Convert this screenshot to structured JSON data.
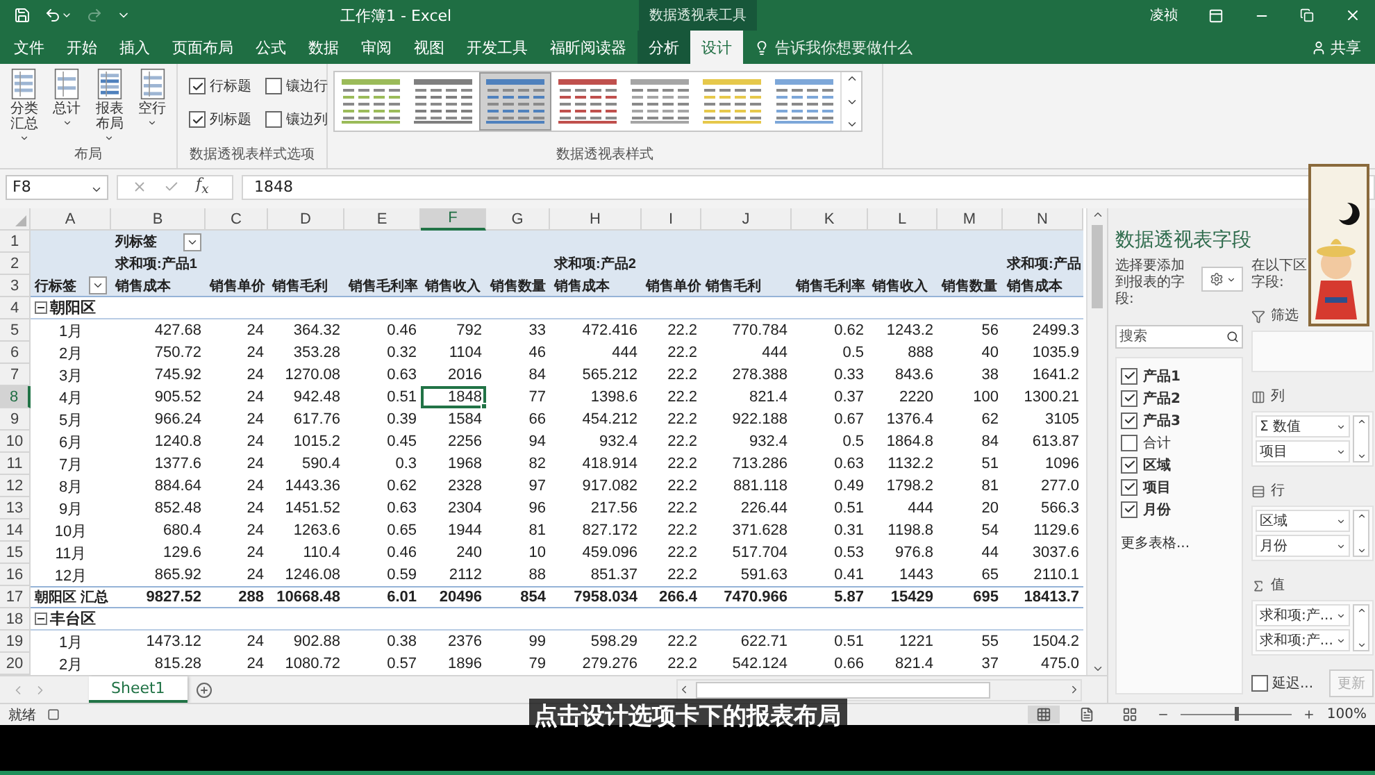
{
  "title_bar": {
    "title": "工作簿1 - Excel",
    "context_header": "数据透视表工具",
    "user": "凌祯"
  },
  "tabs": [
    {
      "label": "文件",
      "selected": false,
      "kind": "normal"
    },
    {
      "label": "开始",
      "selected": false,
      "kind": "normal"
    },
    {
      "label": "插入",
      "selected": false,
      "kind": "normal"
    },
    {
      "label": "页面布局",
      "selected": false,
      "kind": "normal"
    },
    {
      "label": "公式",
      "selected": false,
      "kind": "normal"
    },
    {
      "label": "数据",
      "selected": false,
      "kind": "normal"
    },
    {
      "label": "审阅",
      "selected": false,
      "kind": "normal"
    },
    {
      "label": "视图",
      "selected": false,
      "kind": "normal"
    },
    {
      "label": "开发工具",
      "selected": false,
      "kind": "normal"
    },
    {
      "label": "福昕阅读器",
      "selected": false,
      "kind": "normal"
    },
    {
      "label": "分析",
      "selected": false,
      "kind": "contextual"
    },
    {
      "label": "设计",
      "selected": true,
      "kind": "contextual"
    }
  ],
  "tell_me": {
    "placeholder": "告诉我你想要做什么"
  },
  "share": "共享",
  "ribbon": {
    "layout": {
      "label": "布局",
      "buttons": [
        {
          "label": "分类汇总",
          "kind": "subtotals"
        },
        {
          "label": "总计",
          "kind": "totals"
        },
        {
          "label": "报表布局",
          "kind": "report"
        },
        {
          "label": "空行",
          "kind": "blank"
        }
      ]
    },
    "options": {
      "label": "数据透视表样式选项",
      "items": [
        {
          "label": "行标题",
          "checked": true
        },
        {
          "label": "镶边行",
          "checked": false
        },
        {
          "label": "列标题",
          "checked": true
        },
        {
          "label": "镶边列",
          "checked": false
        }
      ]
    },
    "styles": {
      "label": "数据透视表样式",
      "items": [
        {
          "color": "#9bbb59",
          "selected": false
        },
        {
          "color": "#7f7f7f",
          "selected": false
        },
        {
          "color": "#4f81bd",
          "selected": true
        },
        {
          "color": "#c0504d",
          "selected": false
        },
        {
          "color": "#a5a5a5",
          "selected": false
        },
        {
          "color": "#e6c84b",
          "selected": false
        },
        {
          "color": "#7da7d9",
          "selected": false
        }
      ]
    }
  },
  "formula_bar": {
    "name_box": "F8",
    "fx": "f$_{x}$",
    "value": "1848"
  },
  "table": {
    "columns": [
      {
        "label": "A",
        "selected": false
      },
      {
        "label": "B",
        "selected": false
      },
      {
        "label": "C",
        "selected": false
      },
      {
        "label": "D",
        "selected": false
      },
      {
        "label": "E",
        "selected": false
      },
      {
        "label": "F",
        "selected": true
      },
      {
        "label": "G",
        "selected": false
      },
      {
        "label": "H",
        "selected": false
      },
      {
        "label": "I",
        "selected": false
      },
      {
        "label": "J",
        "selected": false
      },
      {
        "label": "K",
        "selected": false
      },
      {
        "label": "L",
        "selected": false
      },
      {
        "label": "M",
        "selected": false
      },
      {
        "label": "N",
        "selected": false
      }
    ],
    "rows": [
      {
        "num": "1",
        "selected": false,
        "kind": "header",
        "cells": [
          null,
          {
            "text": "列标签",
            "dropdown": true
          }
        ]
      },
      {
        "num": "2",
        "selected": false,
        "kind": "header",
        "cells": [
          null,
          "求和项:产品1",
          null,
          null,
          null,
          null,
          null,
          "求和项:产品2",
          null,
          null,
          null,
          null,
          null,
          "求和项:产品"
        ]
      },
      {
        "num": "3",
        "selected": false,
        "kind": "header",
        "cells": [
          {
            "text": "行标签",
            "dropdown": true
          },
          "销售成本",
          "销售单价",
          "销售毛利",
          "销售毛利率",
          "销售收入",
          "销售数量",
          "销售成本",
          "销售单价",
          "销售毛利",
          "销售毛利率",
          "销售收入",
          "销售数量",
          "销售成本"
        ]
      },
      {
        "num": "4",
        "selected": false,
        "kind": "group",
        "expanded": true,
        "cells": [
          "朝阳区"
        ]
      },
      {
        "num": "5",
        "selected": false,
        "kind": "data",
        "cells": [
          "1月",
          "427.68",
          "24",
          "364.32",
          "0.46",
          "792",
          "33",
          "472.416",
          "22.2",
          "770.784",
          "0.62",
          "1243.2",
          "56",
          "2499.3"
        ]
      },
      {
        "num": "6",
        "selected": false,
        "kind": "data",
        "cells": [
          "2月",
          "750.72",
          "24",
          "353.28",
          "0.32",
          "1104",
          "46",
          "444",
          "22.2",
          "444",
          "0.5",
          "888",
          "40",
          "1035.9"
        ]
      },
      {
        "num": "7",
        "selected": false,
        "kind": "data",
        "cells": [
          "3月",
          "745.92",
          "24",
          "1270.08",
          "0.63",
          "2016",
          "84",
          "565.212",
          "22.2",
          "278.388",
          "0.33",
          "843.6",
          "38",
          "1641.2"
        ]
      },
      {
        "num": "8",
        "selected": true,
        "kind": "data",
        "cells": [
          "4月",
          "905.52",
          "24",
          "942.48",
          "0.51",
          "1848",
          "77",
          "1398.6",
          "22.2",
          "821.4",
          "0.37",
          "2220",
          "100",
          "1300.21"
        ]
      },
      {
        "num": "9",
        "selected": false,
        "kind": "data",
        "cells": [
          "5月",
          "966.24",
          "24",
          "617.76",
          "0.39",
          "1584",
          "66",
          "454.212",
          "22.2",
          "922.188",
          "0.67",
          "1376.4",
          "62",
          "3105"
        ]
      },
      {
        "num": "10",
        "selected": false,
        "kind": "data",
        "cells": [
          "6月",
          "1240.8",
          "24",
          "1015.2",
          "0.45",
          "2256",
          "94",
          "932.4",
          "22.2",
          "932.4",
          "0.5",
          "1864.8",
          "84",
          "613.87"
        ]
      },
      {
        "num": "11",
        "selected": false,
        "kind": "data",
        "cells": [
          "7月",
          "1377.6",
          "24",
          "590.4",
          "0.3",
          "1968",
          "82",
          "418.914",
          "22.2",
          "713.286",
          "0.63",
          "1132.2",
          "51",
          "1096"
        ]
      },
      {
        "num": "12",
        "selected": false,
        "kind": "data",
        "cells": [
          "8月",
          "884.64",
          "24",
          "1443.36",
          "0.62",
          "2328",
          "97",
          "917.082",
          "22.2",
          "881.118",
          "0.49",
          "1798.2",
          "81",
          "277.0"
        ]
      },
      {
        "num": "13",
        "selected": false,
        "kind": "data",
        "cells": [
          "9月",
          "852.48",
          "24",
          "1451.52",
          "0.63",
          "2304",
          "96",
          "217.56",
          "22.2",
          "226.44",
          "0.51",
          "444",
          "20",
          "566.3"
        ]
      },
      {
        "num": "14",
        "selected": false,
        "kind": "data",
        "cells": [
          "10月",
          "680.4",
          "24",
          "1263.6",
          "0.65",
          "1944",
          "81",
          "827.172",
          "22.2",
          "371.628",
          "0.31",
          "1198.8",
          "54",
          "1129.6"
        ]
      },
      {
        "num": "15",
        "selected": false,
        "kind": "data",
        "cells": [
          "11月",
          "129.6",
          "24",
          "110.4",
          "0.46",
          "240",
          "10",
          "459.096",
          "22.2",
          "517.704",
          "0.53",
          "976.8",
          "44",
          "3037.6"
        ]
      },
      {
        "num": "16",
        "selected": false,
        "kind": "data",
        "cells": [
          "12月",
          "865.92",
          "24",
          "1246.08",
          "0.59",
          "2112",
          "88",
          "851.37",
          "22.2",
          "591.63",
          "0.41",
          "1443",
          "65",
          "2110.1"
        ]
      },
      {
        "num": "17",
        "selected": false,
        "kind": "total",
        "cells": [
          "朝阳区 汇总",
          "9827.52",
          "288",
          "10668.48",
          "6.01",
          "20496",
          "854",
          "7958.034",
          "266.4",
          "7470.966",
          "5.87",
          "15429",
          "695",
          "18413.7"
        ]
      },
      {
        "num": "18",
        "selected": false,
        "kind": "group",
        "expanded": true,
        "cells": [
          "丰台区"
        ]
      },
      {
        "num": "19",
        "selected": false,
        "kind": "data",
        "cells": [
          "1月",
          "1473.12",
          "24",
          "902.88",
          "0.38",
          "2376",
          "99",
          "598.29",
          "22.2",
          "622.71",
          "0.51",
          "1221",
          "55",
          "1504.2"
        ]
      },
      {
        "num": "20",
        "selected": false,
        "kind": "data",
        "cells": [
          "2月",
          "815.28",
          "24",
          "1080.72",
          "0.57",
          "1896",
          "79",
          "279.276",
          "22.2",
          "542.124",
          "0.66",
          "821.4",
          "37",
          "475.0"
        ]
      }
    ]
  },
  "sheet_tabs": [
    {
      "label": "Sheet1",
      "selected": true
    }
  ],
  "field_pane": {
    "title": "数据透视表字段",
    "choose_label": "选择要添加到报表的字段:",
    "drag_label": "在以下区",
    "drag_label_2": "字段:",
    "search": {
      "placeholder": "搜索"
    },
    "fields": [
      {
        "label": "产品1",
        "checked": true
      },
      {
        "label": "产品2",
        "checked": true
      },
      {
        "label": "产品3",
        "checked": true
      },
      {
        "label": "合计",
        "checked": false
      },
      {
        "label": "区域",
        "checked": true
      },
      {
        "label": "项目",
        "checked": true
      },
      {
        "label": "月份",
        "checked": true
      }
    ],
    "more_tables": "更多表格...",
    "areas": [
      {
        "kind": "filter",
        "label": "筛选"
      },
      {
        "kind": "columns",
        "label": "列",
        "items": [
          "Σ 数值",
          "项目"
        ]
      },
      {
        "kind": "rows",
        "label": "行",
        "items": [
          "区域",
          "月份"
        ]
      },
      {
        "kind": "values",
        "label": "值",
        "items": [
          "求和项:产...",
          "求和项:产..."
        ]
      }
    ],
    "defer": {
      "label": "延迟...",
      "checked": false
    },
    "update": {
      "label": "更新",
      "disabled": true
    }
  },
  "status_bar": {
    "ready": "就绪",
    "views": [
      {
        "kind": "normal",
        "selected": true
      },
      {
        "kind": "page_layout",
        "selected": false
      },
      {
        "kind": "page_break",
        "selected": false
      }
    ],
    "zoom_slider": {
      "level": 0.5
    },
    "zoom": "100%"
  },
  "subtitle": "点击设计选项卡下的报表布局"
}
